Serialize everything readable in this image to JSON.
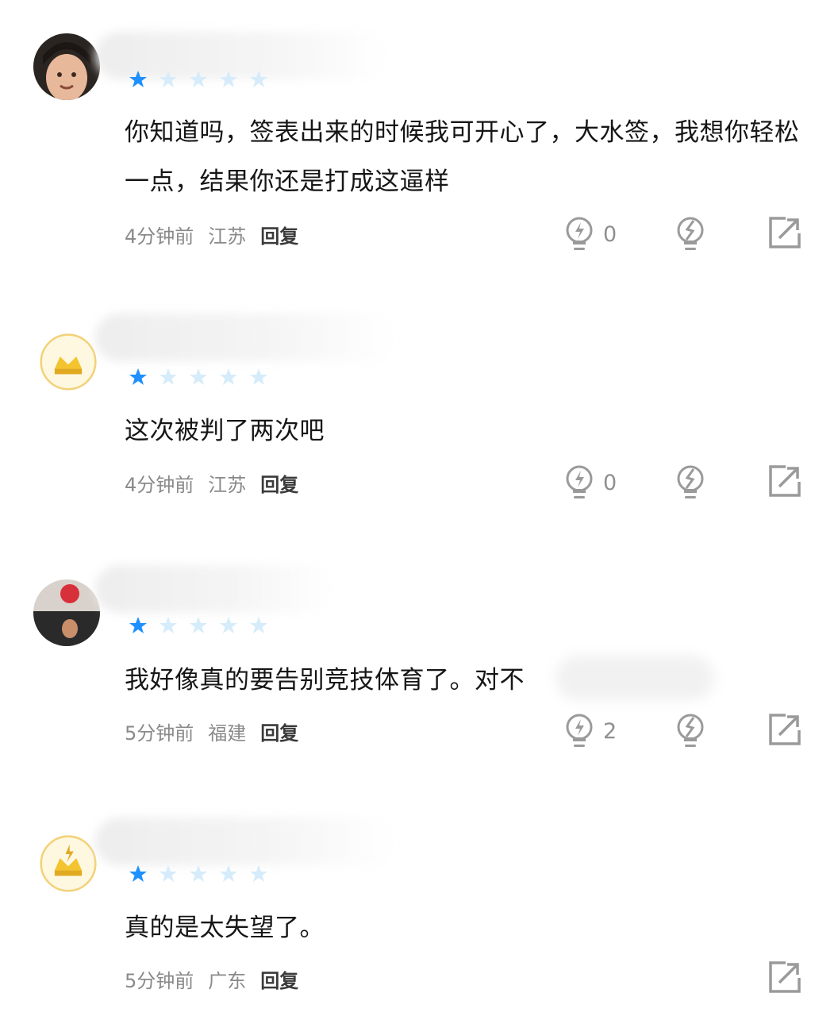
{
  "comments": [
    {
      "text": "你知道吗，签表出来的时候我可开心了，大水签，我想你轻松一点，结果你还是打成这逼样",
      "time": "4分钟前",
      "region": "江苏",
      "reply_label": "回复",
      "like_count": "0",
      "rating_stars": 1,
      "rating_max": 5
    },
    {
      "text": "这次被判了两次吧",
      "time": "4分钟前",
      "region": "江苏",
      "reply_label": "回复",
      "like_count": "0",
      "rating_stars": 1,
      "rating_max": 5
    },
    {
      "text": "我好像真的要告别竞技体育了。对不",
      "time": "5分钟前",
      "region": "福建",
      "reply_label": "回复",
      "like_count": "2",
      "rating_stars": 1,
      "rating_max": 5
    },
    {
      "text": "真的是太失望了。",
      "time": "5分钟前",
      "region": "广东",
      "reply_label": "回复",
      "like_count": "",
      "rating_stars": 1,
      "rating_max": 5
    }
  ],
  "icons": {
    "like": "lightbulb-bolt-icon",
    "dislike": "lightbulb-crack-icon",
    "share": "share-icon",
    "star": "star-icon"
  },
  "colors": {
    "star_filled": "#1e90ff",
    "star_empty": "#d6ecfb",
    "meta_text": "#8a8a8a",
    "reply_text": "#3a3a3a",
    "icon_gray": "#9a9a9a"
  }
}
